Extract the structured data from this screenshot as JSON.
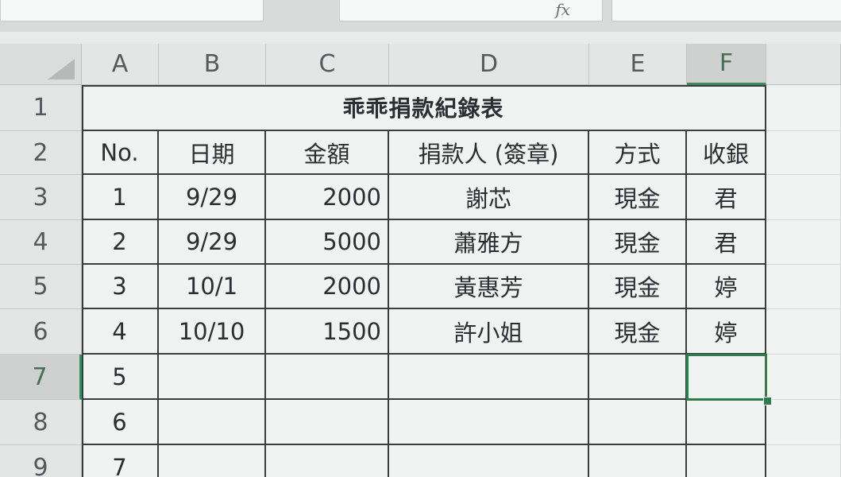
{
  "formula_bar": {
    "fx_label": "fx"
  },
  "columns": [
    "A",
    "B",
    "C",
    "D",
    "E",
    "F"
  ],
  "rows": [
    "1",
    "2",
    "3",
    "4",
    "5",
    "6",
    "7",
    "8",
    "9"
  ],
  "title": "乖乖捐款紀錄表",
  "headers": {
    "no": "No.",
    "date": "日期",
    "amount": "金額",
    "donor": "捐款人 (簽章)",
    "method": "方式",
    "receiver": "收銀"
  },
  "records": [
    {
      "no": "1",
      "date": "9/29",
      "amount": "2000",
      "donor": "謝芯",
      "method": "現金",
      "receiver": "君"
    },
    {
      "no": "2",
      "date": "9/29",
      "amount": "5000",
      "donor": "蕭雅方",
      "method": "現金",
      "receiver": "君"
    },
    {
      "no": "3",
      "date": "10/1",
      "amount": "2000",
      "donor": "黃惠芳",
      "method": "現金",
      "receiver": "婷"
    },
    {
      "no": "4",
      "date": "10/10",
      "amount": "1500",
      "donor": "許小姐",
      "method": "現金",
      "receiver": "婷"
    },
    {
      "no": "5",
      "date": "",
      "amount": "",
      "donor": "",
      "method": "",
      "receiver": ""
    },
    {
      "no": "6",
      "date": "",
      "amount": "",
      "donor": "",
      "method": "",
      "receiver": ""
    },
    {
      "no": "7",
      "date": "",
      "amount": "",
      "donor": "",
      "method": "",
      "receiver": ""
    }
  ],
  "active_column": "F",
  "active_row": "7",
  "colors": {
    "selection": "#2f7d4c",
    "border_dark": "#3a3d3d"
  }
}
